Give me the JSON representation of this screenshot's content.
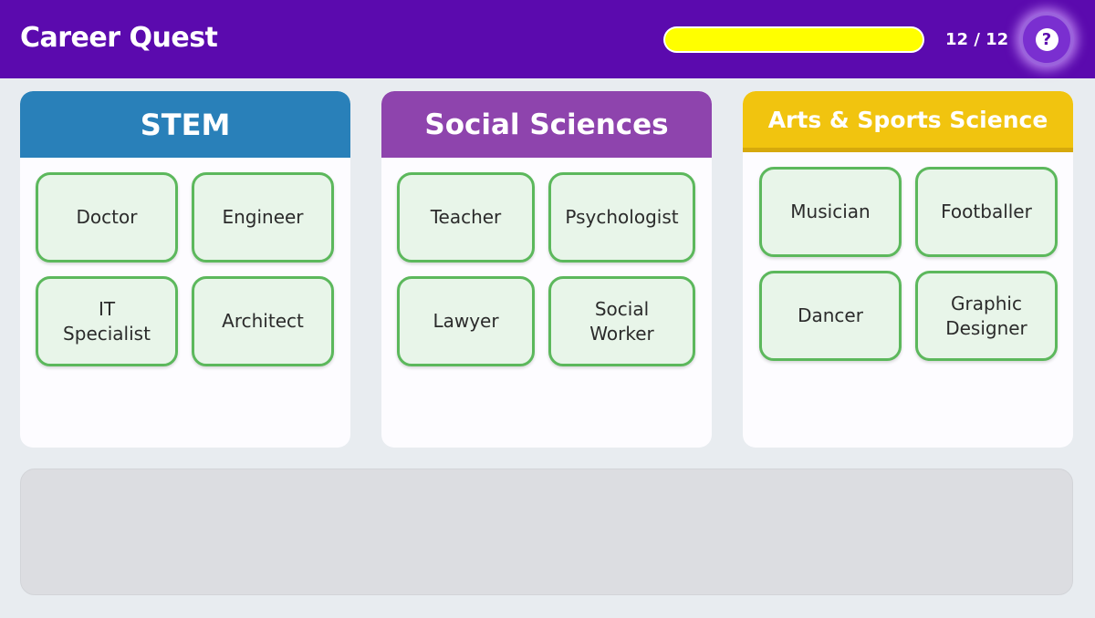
{
  "header": {
    "title": "Career Quest",
    "progress_fraction": 1.0,
    "progress_text": "12 / 12",
    "help_icon": "question-circle-icon",
    "colors": {
      "header_bg": "#5b0aae",
      "progress_fill": "#ffff00"
    }
  },
  "categories": [
    {
      "title": "STEM",
      "color": "#2980b9",
      "careers": [
        "Doctor",
        "Engineer",
        "IT Specialist",
        "Architect"
      ]
    },
    {
      "title": "Social Sciences",
      "color": "#8e44ad",
      "careers": [
        "Teacher",
        "Psychologist",
        "Lawyer",
        "Social Worker"
      ]
    },
    {
      "title": "Arts & Sports Science",
      "color": "#f1c40f",
      "careers": [
        "Musician",
        "Footballer",
        "Dancer",
        "Graphic Designer"
      ]
    }
  ],
  "tray": {
    "items": []
  }
}
